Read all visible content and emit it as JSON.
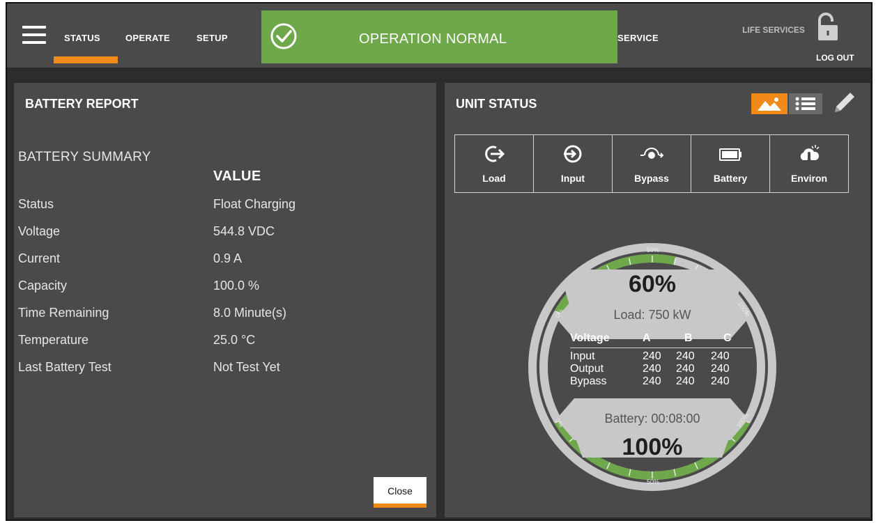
{
  "nav": {
    "status": "STATUS",
    "operate": "OPERATE",
    "setup": "SETUP",
    "service": "SERVICE",
    "life_services": "LIFE SERVICES",
    "logout": "LOG OUT"
  },
  "banner": {
    "text": "OPERATION NORMAL",
    "color": "#6fa84a"
  },
  "battery_report": {
    "title": "BATTERY REPORT",
    "summary_title": "BATTERY SUMMARY",
    "value_header": "VALUE",
    "rows": [
      {
        "label": "Status",
        "value": "Float Charging"
      },
      {
        "label": "Voltage",
        "value": "544.8 VDC"
      },
      {
        "label": "Current",
        "value": "0.9 A"
      },
      {
        "label": "Capacity",
        "value": "100.0 %"
      },
      {
        "label": "Time Remaining",
        "value": "8.0 Minute(s)"
      },
      {
        "label": "Temperature",
        "value": "25.0 °C"
      },
      {
        "label": "Last Battery Test",
        "value": "Not Test Yet"
      }
    ],
    "close_label": "Close"
  },
  "unit_status": {
    "title": "UNIT STATUS",
    "tabs": [
      {
        "label": "Load",
        "icon": "load-icon"
      },
      {
        "label": "Input",
        "icon": "input-icon"
      },
      {
        "label": "Bypass",
        "icon": "bypass-icon"
      },
      {
        "label": "Battery",
        "icon": "battery-icon"
      },
      {
        "label": "Environ",
        "icon": "environ-icon"
      }
    ],
    "gauge": {
      "load_percent": "60%",
      "load_text": "Load: 750 kW",
      "load_fraction": 0.6,
      "battery_time_text": "Battery: 00:08:00",
      "battery_percent": "100%",
      "battery_fraction": 1.0,
      "scale_labels": {
        "zero": "0%",
        "fifty": "50%",
        "hundred": "100%"
      },
      "voltage_table": {
        "headers": [
          "Voltage",
          "A",
          "B",
          "C"
        ],
        "rows": [
          {
            "name": "Input",
            "a": "240",
            "b": "240",
            "c": "240"
          },
          {
            "name": "Output",
            "a": "240",
            "b": "240",
            "c": "240"
          },
          {
            "name": "Bypass",
            "a": "240",
            "b": "240",
            "c": "240"
          }
        ]
      }
    }
  },
  "colors": {
    "accent": "#f28a1a",
    "gauge_green": "#6fa84a",
    "panel": "#4a4a4a"
  }
}
